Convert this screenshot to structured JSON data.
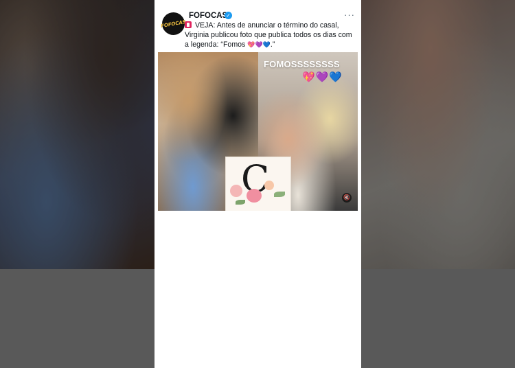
{
  "post": {
    "author_name": "FOFOCAS",
    "avatar_logo": "FOFOCAS",
    "verified_badge": "✓",
    "more_menu": "···",
    "text_prefix": "VEJA: Antes de anunciar o término do casal, Virginia publicou foto que publica todos os dias com a legenda: “Fomos",
    "text_hearts": "💖💜💙",
    "text_suffix": ".”"
  },
  "media": {
    "story_caption": "FOMOSSSSSSSS",
    "story_hearts": "💖💜💙",
    "mute_icon": "🔇",
    "stamp_letter": "C"
  },
  "icons": {
    "alert": "siren-icon",
    "verified": "verified-badge-icon",
    "more": "more-options-icon",
    "mute": "mute-icon"
  },
  "colors": {
    "verified": "#1d9bf0",
    "text": "#0f1419",
    "muted": "#536471"
  }
}
